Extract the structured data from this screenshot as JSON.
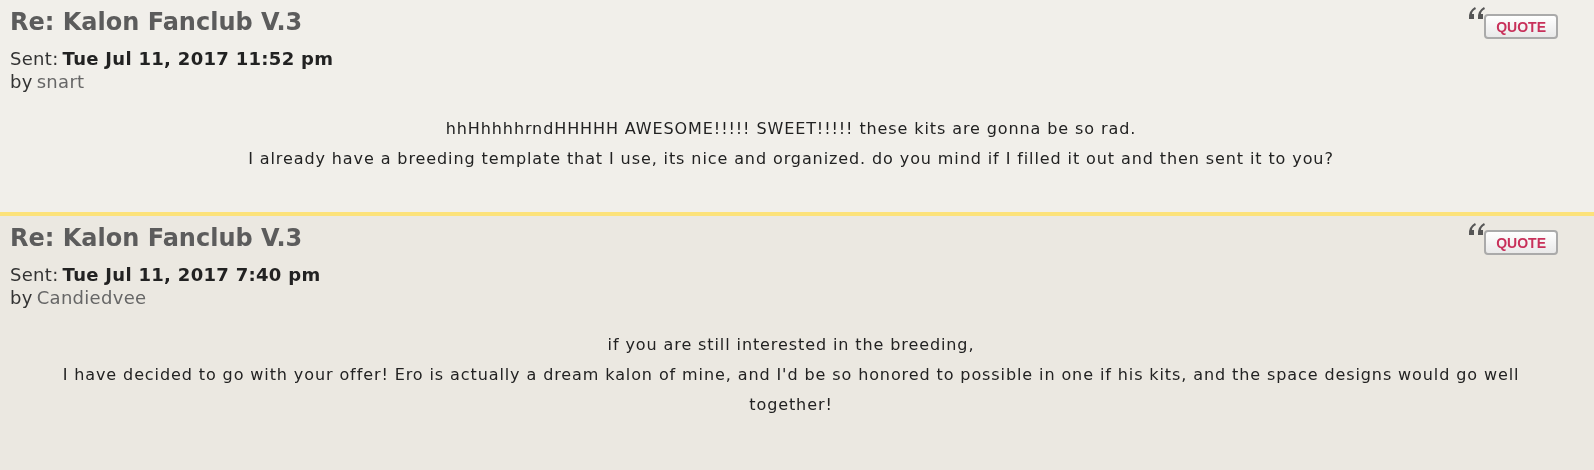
{
  "posts": [
    {
      "title": "Re: Kalon Fanclub V.3",
      "sent_label": "Sent:",
      "date": "Tue Jul 11, 2017 11:52 pm",
      "by_label": "by",
      "author": "snart",
      "quote_button": "QUOTE",
      "body": [
        "hhHhhhhrndHHHHH AWESOME!!!!! SWEET!!!!! these kits are gonna be so rad.",
        "I already have a breeding template that I use, its nice and organized. do you mind if I filled it out and then sent it to you?"
      ]
    },
    {
      "title": "Re: Kalon Fanclub V.3",
      "sent_label": "Sent:",
      "date": "Tue Jul 11, 2017 7:40 pm",
      "by_label": "by",
      "author": "Candiedvee",
      "quote_button": "QUOTE",
      "body": [
        "if you are still interested in the breeding,",
        "I have decided to go with your offer! Ero is actually a dream kalon of mine, and I'd be so honored to possible in one if his kits, and the space designs would go well together!"
      ]
    }
  ]
}
